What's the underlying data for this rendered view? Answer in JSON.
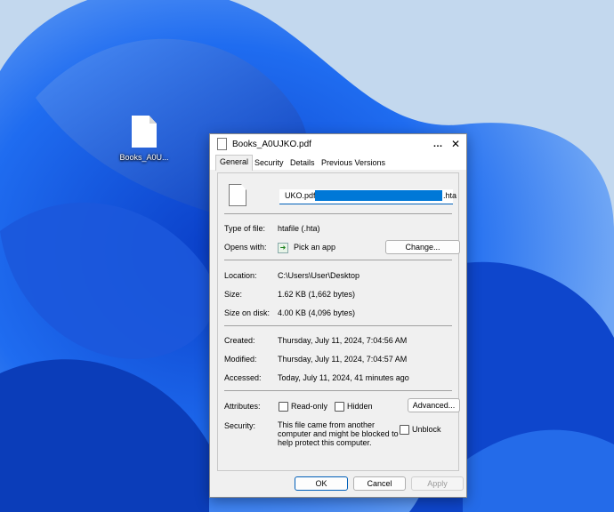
{
  "desktop": {
    "icon_label": "Books_A0U..."
  },
  "window": {
    "title": "Books_A0UJKO.pdf",
    "help": "…",
    "close": "✕"
  },
  "tabs": [
    "General",
    "Security",
    "Details",
    "Previous Versions"
  ],
  "general": {
    "filename": {
      "prefix": "UKO.pdf",
      "suffix": ".hta"
    },
    "type_label": "Type of file:",
    "type_value": "htafile (.hta)",
    "opens_label": "Opens with:",
    "opens_value": "Pick an app",
    "change_button": "Change...",
    "location_label": "Location:",
    "location_value": "C:\\Users\\User\\Desktop",
    "size_label": "Size:",
    "size_value": "1.62 KB (1,662 bytes)",
    "size_disk_label": "Size on disk:",
    "size_disk_value": "4.00 KB (4,096 bytes)",
    "created_label": "Created:",
    "created_value": "Thursday, July 11, 2024, 7:04:56 AM",
    "modified_label": "Modified:",
    "modified_value": "Thursday, July 11, 2024, 7:04:57 AM",
    "accessed_label": "Accessed:",
    "accessed_value": "Today, July 11, 2024, 41 minutes ago",
    "attributes_label": "Attributes:",
    "readonly_label": "Read-only",
    "hidden_label": "Hidden",
    "advanced_button": "Advanced...",
    "security_label": "Security:",
    "security_line1": "This file came from another",
    "security_line2": "computer and might be blocked to",
    "security_line3": "help protect this computer.",
    "unblock_label": "Unblock"
  },
  "footer": {
    "ok": "OK",
    "cancel": "Cancel",
    "apply": "Apply"
  },
  "colors": {
    "accent": "#005fb8",
    "selection": "#0078d7",
    "wallpaper_blue": "#1a5fe0"
  }
}
